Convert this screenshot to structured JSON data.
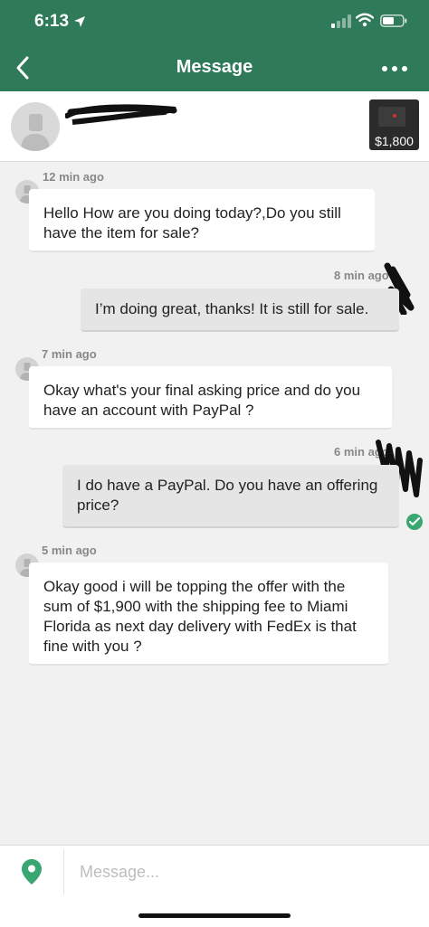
{
  "status_bar": {
    "time": "6:13"
  },
  "nav": {
    "title": "Message"
  },
  "listing": {
    "price": "$1,800"
  },
  "messages": [
    {
      "direction": "incoming",
      "time": "12 min ago",
      "text": "Hello How are you doing today?,Do you still have the item for sale?"
    },
    {
      "direction": "outgoing",
      "time": "8 min ago",
      "text": "I’m doing great, thanks! It is still for sale."
    },
    {
      "direction": "incoming",
      "time": "7 min ago",
      "text": "Okay what's your final asking price and do you have an account with PayPal ?"
    },
    {
      "direction": "outgoing",
      "time": "6 min ago",
      "text": "I do have a PayPal. Do you have an offering price?",
      "read": true
    },
    {
      "direction": "incoming",
      "time": "5 min ago",
      "text": "Okay good i will be topping the offer with the sum of $1,900 with the shipping fee to Miami Florida as next day delivery with FedEx is that fine with you ?"
    }
  ],
  "composer": {
    "placeholder": "Message..."
  },
  "colors": {
    "header_green": "#2f7a58",
    "read_green": "#3aa672"
  },
  "icons": [
    "location-arrow-icon",
    "signal-icon",
    "wifi-icon",
    "battery-icon",
    "back-chevron-icon",
    "more-dots-icon",
    "person-icon",
    "check-icon",
    "map-pin-icon"
  ]
}
